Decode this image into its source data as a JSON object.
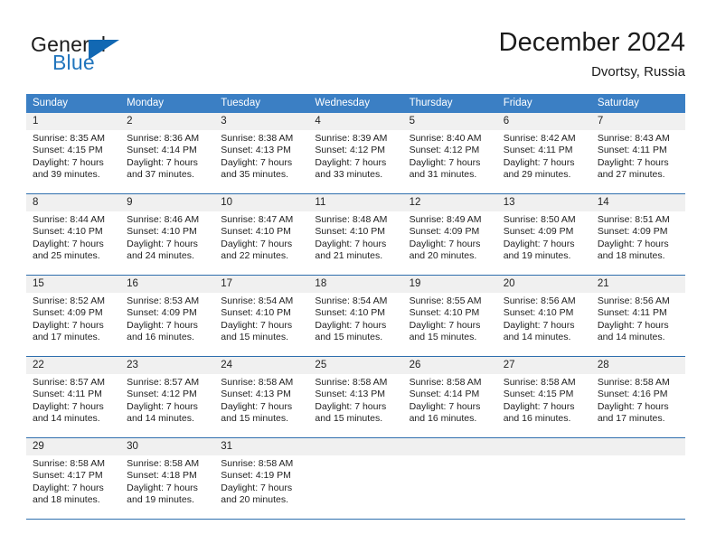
{
  "brand": {
    "name_top": "General",
    "name_bottom": "Blue",
    "accent_color": "#1268b3"
  },
  "header": {
    "month_title": "December 2024",
    "location": "Dvortsy, Russia"
  },
  "calendar": {
    "header_color": "#3b7fc4",
    "weekdays": [
      "Sunday",
      "Monday",
      "Tuesday",
      "Wednesday",
      "Thursday",
      "Friday",
      "Saturday"
    ],
    "weeks": [
      [
        {
          "day": "1",
          "sunrise": "Sunrise: 8:35 AM",
          "sunset": "Sunset: 4:15 PM",
          "daylight_1": "Daylight: 7 hours",
          "daylight_2": "and 39 minutes."
        },
        {
          "day": "2",
          "sunrise": "Sunrise: 8:36 AM",
          "sunset": "Sunset: 4:14 PM",
          "daylight_1": "Daylight: 7 hours",
          "daylight_2": "and 37 minutes."
        },
        {
          "day": "3",
          "sunrise": "Sunrise: 8:38 AM",
          "sunset": "Sunset: 4:13 PM",
          "daylight_1": "Daylight: 7 hours",
          "daylight_2": "and 35 minutes."
        },
        {
          "day": "4",
          "sunrise": "Sunrise: 8:39 AM",
          "sunset": "Sunset: 4:12 PM",
          "daylight_1": "Daylight: 7 hours",
          "daylight_2": "and 33 minutes."
        },
        {
          "day": "5",
          "sunrise": "Sunrise: 8:40 AM",
          "sunset": "Sunset: 4:12 PM",
          "daylight_1": "Daylight: 7 hours",
          "daylight_2": "and 31 minutes."
        },
        {
          "day": "6",
          "sunrise": "Sunrise: 8:42 AM",
          "sunset": "Sunset: 4:11 PM",
          "daylight_1": "Daylight: 7 hours",
          "daylight_2": "and 29 minutes."
        },
        {
          "day": "7",
          "sunrise": "Sunrise: 8:43 AM",
          "sunset": "Sunset: 4:11 PM",
          "daylight_1": "Daylight: 7 hours",
          "daylight_2": "and 27 minutes."
        }
      ],
      [
        {
          "day": "8",
          "sunrise": "Sunrise: 8:44 AM",
          "sunset": "Sunset: 4:10 PM",
          "daylight_1": "Daylight: 7 hours",
          "daylight_2": "and 25 minutes."
        },
        {
          "day": "9",
          "sunrise": "Sunrise: 8:46 AM",
          "sunset": "Sunset: 4:10 PM",
          "daylight_1": "Daylight: 7 hours",
          "daylight_2": "and 24 minutes."
        },
        {
          "day": "10",
          "sunrise": "Sunrise: 8:47 AM",
          "sunset": "Sunset: 4:10 PM",
          "daylight_1": "Daylight: 7 hours",
          "daylight_2": "and 22 minutes."
        },
        {
          "day": "11",
          "sunrise": "Sunrise: 8:48 AM",
          "sunset": "Sunset: 4:10 PM",
          "daylight_1": "Daylight: 7 hours",
          "daylight_2": "and 21 minutes."
        },
        {
          "day": "12",
          "sunrise": "Sunrise: 8:49 AM",
          "sunset": "Sunset: 4:09 PM",
          "daylight_1": "Daylight: 7 hours",
          "daylight_2": "and 20 minutes."
        },
        {
          "day": "13",
          "sunrise": "Sunrise: 8:50 AM",
          "sunset": "Sunset: 4:09 PM",
          "daylight_1": "Daylight: 7 hours",
          "daylight_2": "and 19 minutes."
        },
        {
          "day": "14",
          "sunrise": "Sunrise: 8:51 AM",
          "sunset": "Sunset: 4:09 PM",
          "daylight_1": "Daylight: 7 hours",
          "daylight_2": "and 18 minutes."
        }
      ],
      [
        {
          "day": "15",
          "sunrise": "Sunrise: 8:52 AM",
          "sunset": "Sunset: 4:09 PM",
          "daylight_1": "Daylight: 7 hours",
          "daylight_2": "and 17 minutes."
        },
        {
          "day": "16",
          "sunrise": "Sunrise: 8:53 AM",
          "sunset": "Sunset: 4:09 PM",
          "daylight_1": "Daylight: 7 hours",
          "daylight_2": "and 16 minutes."
        },
        {
          "day": "17",
          "sunrise": "Sunrise: 8:54 AM",
          "sunset": "Sunset: 4:10 PM",
          "daylight_1": "Daylight: 7 hours",
          "daylight_2": "and 15 minutes."
        },
        {
          "day": "18",
          "sunrise": "Sunrise: 8:54 AM",
          "sunset": "Sunset: 4:10 PM",
          "daylight_1": "Daylight: 7 hours",
          "daylight_2": "and 15 minutes."
        },
        {
          "day": "19",
          "sunrise": "Sunrise: 8:55 AM",
          "sunset": "Sunset: 4:10 PM",
          "daylight_1": "Daylight: 7 hours",
          "daylight_2": "and 15 minutes."
        },
        {
          "day": "20",
          "sunrise": "Sunrise: 8:56 AM",
          "sunset": "Sunset: 4:10 PM",
          "daylight_1": "Daylight: 7 hours",
          "daylight_2": "and 14 minutes."
        },
        {
          "day": "21",
          "sunrise": "Sunrise: 8:56 AM",
          "sunset": "Sunset: 4:11 PM",
          "daylight_1": "Daylight: 7 hours",
          "daylight_2": "and 14 minutes."
        }
      ],
      [
        {
          "day": "22",
          "sunrise": "Sunrise: 8:57 AM",
          "sunset": "Sunset: 4:11 PM",
          "daylight_1": "Daylight: 7 hours",
          "daylight_2": "and 14 minutes."
        },
        {
          "day": "23",
          "sunrise": "Sunrise: 8:57 AM",
          "sunset": "Sunset: 4:12 PM",
          "daylight_1": "Daylight: 7 hours",
          "daylight_2": "and 14 minutes."
        },
        {
          "day": "24",
          "sunrise": "Sunrise: 8:58 AM",
          "sunset": "Sunset: 4:13 PM",
          "daylight_1": "Daylight: 7 hours",
          "daylight_2": "and 15 minutes."
        },
        {
          "day": "25",
          "sunrise": "Sunrise: 8:58 AM",
          "sunset": "Sunset: 4:13 PM",
          "daylight_1": "Daylight: 7 hours",
          "daylight_2": "and 15 minutes."
        },
        {
          "day": "26",
          "sunrise": "Sunrise: 8:58 AM",
          "sunset": "Sunset: 4:14 PM",
          "daylight_1": "Daylight: 7 hours",
          "daylight_2": "and 16 minutes."
        },
        {
          "day": "27",
          "sunrise": "Sunrise: 8:58 AM",
          "sunset": "Sunset: 4:15 PM",
          "daylight_1": "Daylight: 7 hours",
          "daylight_2": "and 16 minutes."
        },
        {
          "day": "28",
          "sunrise": "Sunrise: 8:58 AM",
          "sunset": "Sunset: 4:16 PM",
          "daylight_1": "Daylight: 7 hours",
          "daylight_2": "and 17 minutes."
        }
      ],
      [
        {
          "day": "29",
          "sunrise": "Sunrise: 8:58 AM",
          "sunset": "Sunset: 4:17 PM",
          "daylight_1": "Daylight: 7 hours",
          "daylight_2": "and 18 minutes."
        },
        {
          "day": "30",
          "sunrise": "Sunrise: 8:58 AM",
          "sunset": "Sunset: 4:18 PM",
          "daylight_1": "Daylight: 7 hours",
          "daylight_2": "and 19 minutes."
        },
        {
          "day": "31",
          "sunrise": "Sunrise: 8:58 AM",
          "sunset": "Sunset: 4:19 PM",
          "daylight_1": "Daylight: 7 hours",
          "daylight_2": "and 20 minutes."
        },
        {
          "day": "",
          "sunrise": "",
          "sunset": "",
          "daylight_1": "",
          "daylight_2": ""
        },
        {
          "day": "",
          "sunrise": "",
          "sunset": "",
          "daylight_1": "",
          "daylight_2": ""
        },
        {
          "day": "",
          "sunrise": "",
          "sunset": "",
          "daylight_1": "",
          "daylight_2": ""
        },
        {
          "day": "",
          "sunrise": "",
          "sunset": "",
          "daylight_1": "",
          "daylight_2": ""
        }
      ]
    ]
  }
}
